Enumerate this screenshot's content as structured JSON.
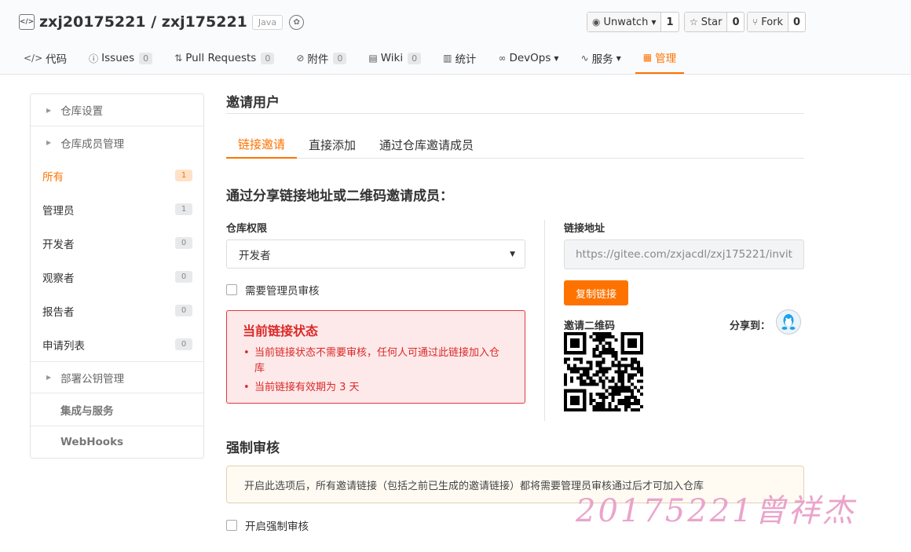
{
  "repo": {
    "owner": "zxj20175221",
    "separator": " / ",
    "name": "zxj175221",
    "language": "Java",
    "path": "zxj20175221 / zxj175221"
  },
  "actions": {
    "watch": {
      "label": "Unwatch",
      "count": "1"
    },
    "star": {
      "label": "Star",
      "count": "0"
    },
    "fork": {
      "label": "Fork",
      "count": "0"
    }
  },
  "nav": {
    "items": [
      {
        "label": "代码",
        "icon": "code-icon"
      },
      {
        "label": "Issues",
        "count": "0",
        "icon": "issue-icon"
      },
      {
        "label": "Pull Requests",
        "count": "0",
        "icon": "pull-request-icon"
      },
      {
        "label": "附件",
        "count": "0",
        "icon": "paperclip-icon"
      },
      {
        "label": "Wiki",
        "count": "0",
        "icon": "book-icon"
      },
      {
        "label": "统计",
        "icon": "bar-chart-icon"
      },
      {
        "label": "DevOps",
        "icon": "infinity-icon"
      },
      {
        "label": "服务",
        "icon": "pulse-icon"
      },
      {
        "label": "管理",
        "icon": "manage-icon",
        "active": true
      }
    ]
  },
  "sidebar": {
    "repo_settings": "仓库设置",
    "member_management": "仓库成员管理",
    "members": [
      {
        "label": "所有",
        "count": "1"
      },
      {
        "label": "管理员",
        "count": "1"
      },
      {
        "label": "开发者",
        "count": "0"
      },
      {
        "label": "观察者",
        "count": "0"
      },
      {
        "label": "报告者",
        "count": "0"
      },
      {
        "label": "申请列表",
        "count": "0"
      }
    ],
    "deploy_keys": "部署公钥管理",
    "integrations": "集成与服务",
    "webhooks": "WebHooks"
  },
  "main": {
    "title": "邀请用户",
    "tabs": [
      "链接邀请",
      "直接添加",
      "通过仓库邀请成员"
    ],
    "subtitle": "通过分享链接地址或二维码邀请成员：",
    "permission_label": "仓库权限",
    "permission_value": "开发者",
    "require_review": "需要管理员审核",
    "status": {
      "title": "当前链接状态",
      "items": [
        "当前链接状态不需要审核，任何人可通过此链接加入仓库",
        "当前链接有效期为 3 天"
      ]
    },
    "link_label": "链接地址",
    "link_value": "https://gitee.com/zxjacdl/zxj175221/invit",
    "copy_button": "复制链接",
    "qr_label": "邀请二维码",
    "share_label": "分享到：",
    "force_title": "强制审核",
    "force_notice": "开启此选项后，所有邀请链接（包括之前已生成的邀请链接）都将需要管理员审核通过后才可加入仓库",
    "force_check": "开启强制审核"
  },
  "watermark": "20175221曾祥杰",
  "colors": {
    "accent": "#fe7300",
    "danger": "#db2828"
  }
}
